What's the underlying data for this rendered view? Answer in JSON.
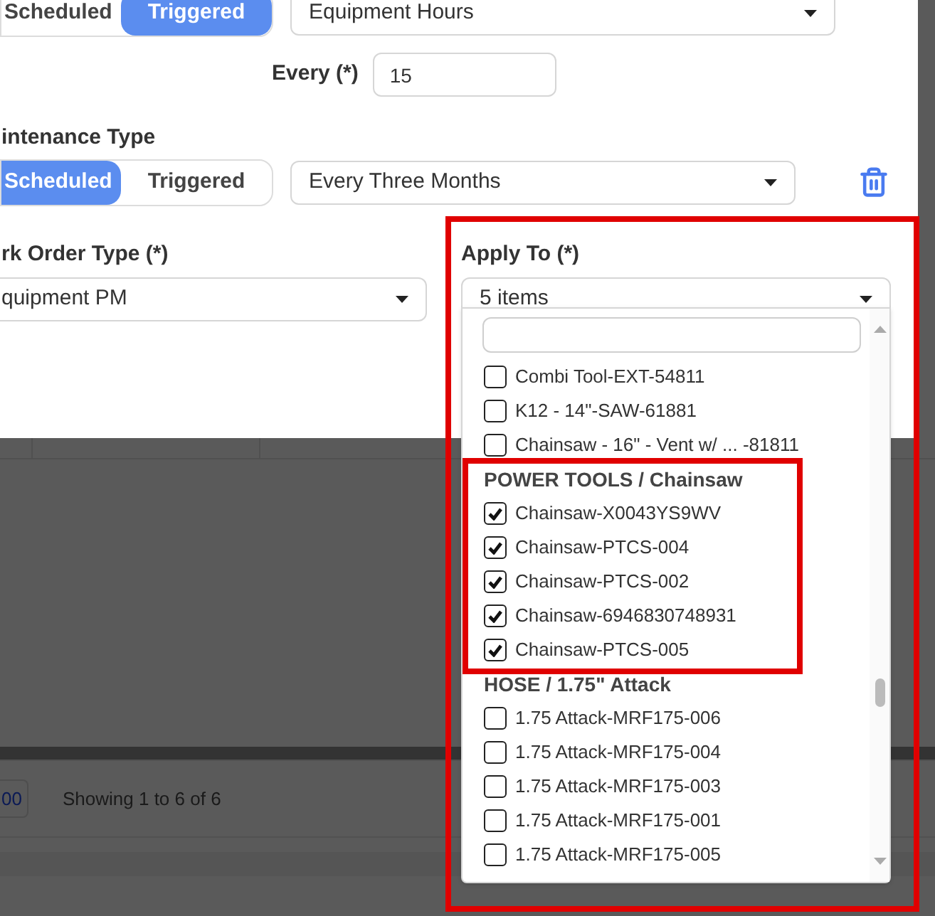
{
  "trigger_row": {
    "toggle": [
      {
        "label": "Scheduled",
        "selected": false
      },
      {
        "label": "Triggered",
        "selected": true
      }
    ],
    "select": "Equipment Hours"
  },
  "every": {
    "label": "Every (*)",
    "value": "15"
  },
  "maintenance_type": {
    "label": "intenance Type",
    "toggle": [
      {
        "label": "Scheduled",
        "selected": true
      },
      {
        "label": "Triggered",
        "selected": false
      }
    ],
    "select": "Every Three Months"
  },
  "work_order_type": {
    "label": "rk Order Type (*)",
    "value": "quipment PM"
  },
  "apply_to": {
    "label": "Apply To (*)",
    "value": "5 items",
    "groups": [
      {
        "items": [
          {
            "label": "Combi Tool-EXT-54811",
            "checked": false
          },
          {
            "label": "K12 - 14\"-SAW-61881",
            "checked": false
          },
          {
            "label": "Chainsaw - 16\" - Vent w/ ... -81811",
            "checked": false
          }
        ]
      },
      {
        "header": "POWER TOOLS / Chainsaw",
        "items": [
          {
            "label": "Chainsaw-X0043YS9WV",
            "checked": true
          },
          {
            "label": "Chainsaw-PTCS-004",
            "checked": true
          },
          {
            "label": "Chainsaw-PTCS-002",
            "checked": true
          },
          {
            "label": "Chainsaw-6946830748931",
            "checked": true
          },
          {
            "label": "Chainsaw-PTCS-005",
            "checked": true
          }
        ]
      },
      {
        "header": "HOSE / 1.75\" Attack",
        "items": [
          {
            "label": "1.75 Attack-MRF175-006",
            "checked": false
          },
          {
            "label": "1.75 Attack-MRF175-004",
            "checked": false
          },
          {
            "label": "1.75 Attack-MRF175-003",
            "checked": false
          },
          {
            "label": "1.75 Attack-MRF175-001",
            "checked": false
          },
          {
            "label": "1.75 Attack-MRF175-005",
            "checked": false
          }
        ]
      }
    ]
  },
  "page_footer": {
    "page_size": "00",
    "showing": "Showing 1 to 6 of 6"
  }
}
